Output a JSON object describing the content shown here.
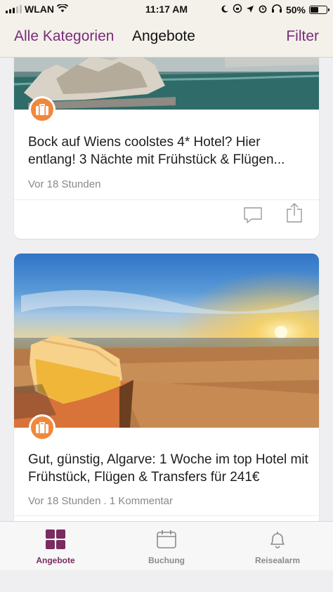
{
  "status_bar": {
    "carrier": "WLAN",
    "time": "11:17 AM",
    "battery": "50%",
    "battery_level": 0.5
  },
  "nav": {
    "back_label": "Alle Kategorien",
    "title": "Angebote",
    "filter_label": "Filter"
  },
  "feed": {
    "cards": [
      {
        "title": "Bock auf Wiens coolstes 4* Hotel? Hier entlang! 3 Nächte mit Frühstück & Flügen...",
        "meta": "Vor 18 Stunden",
        "icon": "suitcase-icon"
      },
      {
        "title": "Gut, günstig, Algarve: 1 Woche im top Hotel mit Frühstück, Flügen & Transfers für 241€",
        "meta": "Vor 18 Stunden . 1 Kommentar",
        "icon": "suitcase-icon"
      }
    ]
  },
  "tabbar": {
    "tabs": [
      {
        "label": "Angebote",
        "icon": "grid-icon",
        "active": true
      },
      {
        "label": "Buchung",
        "icon": "calendar-icon",
        "active": false
      },
      {
        "label": "Reisealarm",
        "icon": "bell-icon",
        "active": false
      }
    ]
  },
  "colors": {
    "brand_purple": "#7a2b7a",
    "badge_orange": "#f0883c",
    "tab_active": "#7a2b5f",
    "tab_inactive": "#8a8a8a"
  }
}
